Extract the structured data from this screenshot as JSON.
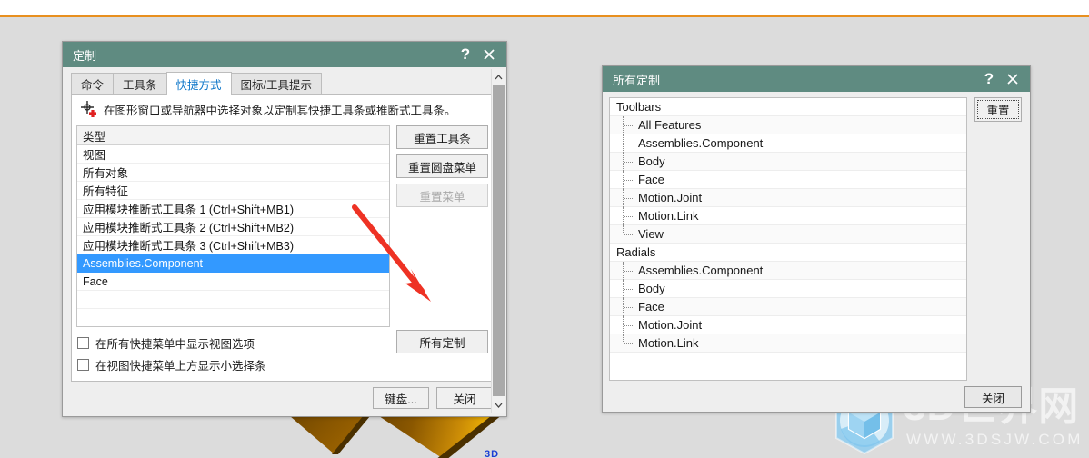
{
  "background": {
    "accent_orange": "#e8901f",
    "canvas_color": "#dcdcdc",
    "blue_fragment": "3D"
  },
  "watermark": {
    "main_text": "3D世界网",
    "sub_text": "WWW.3DSJW.COM",
    "logo_name": "hexagon-cube-logo"
  },
  "customize_dialog": {
    "title": "定制",
    "help_label": "?",
    "close_label": "✕",
    "tabs": [
      {
        "label": "命令",
        "active": false
      },
      {
        "label": "工具条",
        "active": false
      },
      {
        "label": "快捷方式",
        "active": true
      },
      {
        "label": "图标/工具提示",
        "active": false
      }
    ],
    "hint_text": "在图形窗口或导航器中选择对象以定制其快捷工具条或推断式工具条。",
    "list_headers": [
      "类型",
      ""
    ],
    "list_rows": [
      {
        "label": "视图",
        "selected": false
      },
      {
        "label": "所有对象",
        "selected": false
      },
      {
        "label": "所有特征",
        "selected": false
      },
      {
        "label": "应用模块推断式工具条 1 (Ctrl+Shift+MB1)",
        "selected": false
      },
      {
        "label": "应用模块推断式工具条 2 (Ctrl+Shift+MB2)",
        "selected": false
      },
      {
        "label": "应用模块推断式工具条 3 (Ctrl+Shift+MB3)",
        "selected": false
      },
      {
        "label": "Assemblies.Component",
        "selected": true
      },
      {
        "label": "Face",
        "selected": false
      }
    ],
    "side_buttons": {
      "reset_toolbar": "重置工具条",
      "reset_radial": "重置圆盘菜单",
      "reset_menu": "重置菜单",
      "all_customize": "所有定制"
    },
    "checkboxes": [
      {
        "label": "在所有快捷菜单中显示视图选项",
        "checked": false
      },
      {
        "label": "在视图快捷菜单上方显示小选择条",
        "checked": false
      }
    ],
    "footer_buttons": {
      "keyboard": "键盘...",
      "close": "关闭"
    },
    "selection_color": "#3399ff",
    "titlebar_color": "#5f8b81"
  },
  "annotation": {
    "arrow_color": "#ee3224",
    "arrow_name": "red-pointer-arrow"
  },
  "all_customize_dialog": {
    "title": "所有定制",
    "help_label": "?",
    "close_label": "✕",
    "reset_button": "重置",
    "close_button": "关闭",
    "tree": [
      {
        "label": "Toolbars",
        "type": "group"
      },
      {
        "label": "All Features",
        "type": "child"
      },
      {
        "label": "Assemblies.Component",
        "type": "child"
      },
      {
        "label": "Body",
        "type": "child"
      },
      {
        "label": "Face",
        "type": "child"
      },
      {
        "label": "Motion.Joint",
        "type": "child"
      },
      {
        "label": "Motion.Link",
        "type": "child"
      },
      {
        "label": "View",
        "type": "child",
        "last": true
      },
      {
        "label": "Radials",
        "type": "group"
      },
      {
        "label": "Assemblies.Component",
        "type": "child"
      },
      {
        "label": "Body",
        "type": "child"
      },
      {
        "label": "Face",
        "type": "child"
      },
      {
        "label": "Motion.Joint",
        "type": "child"
      },
      {
        "label": "Motion.Link",
        "type": "child",
        "last": true
      }
    ]
  }
}
